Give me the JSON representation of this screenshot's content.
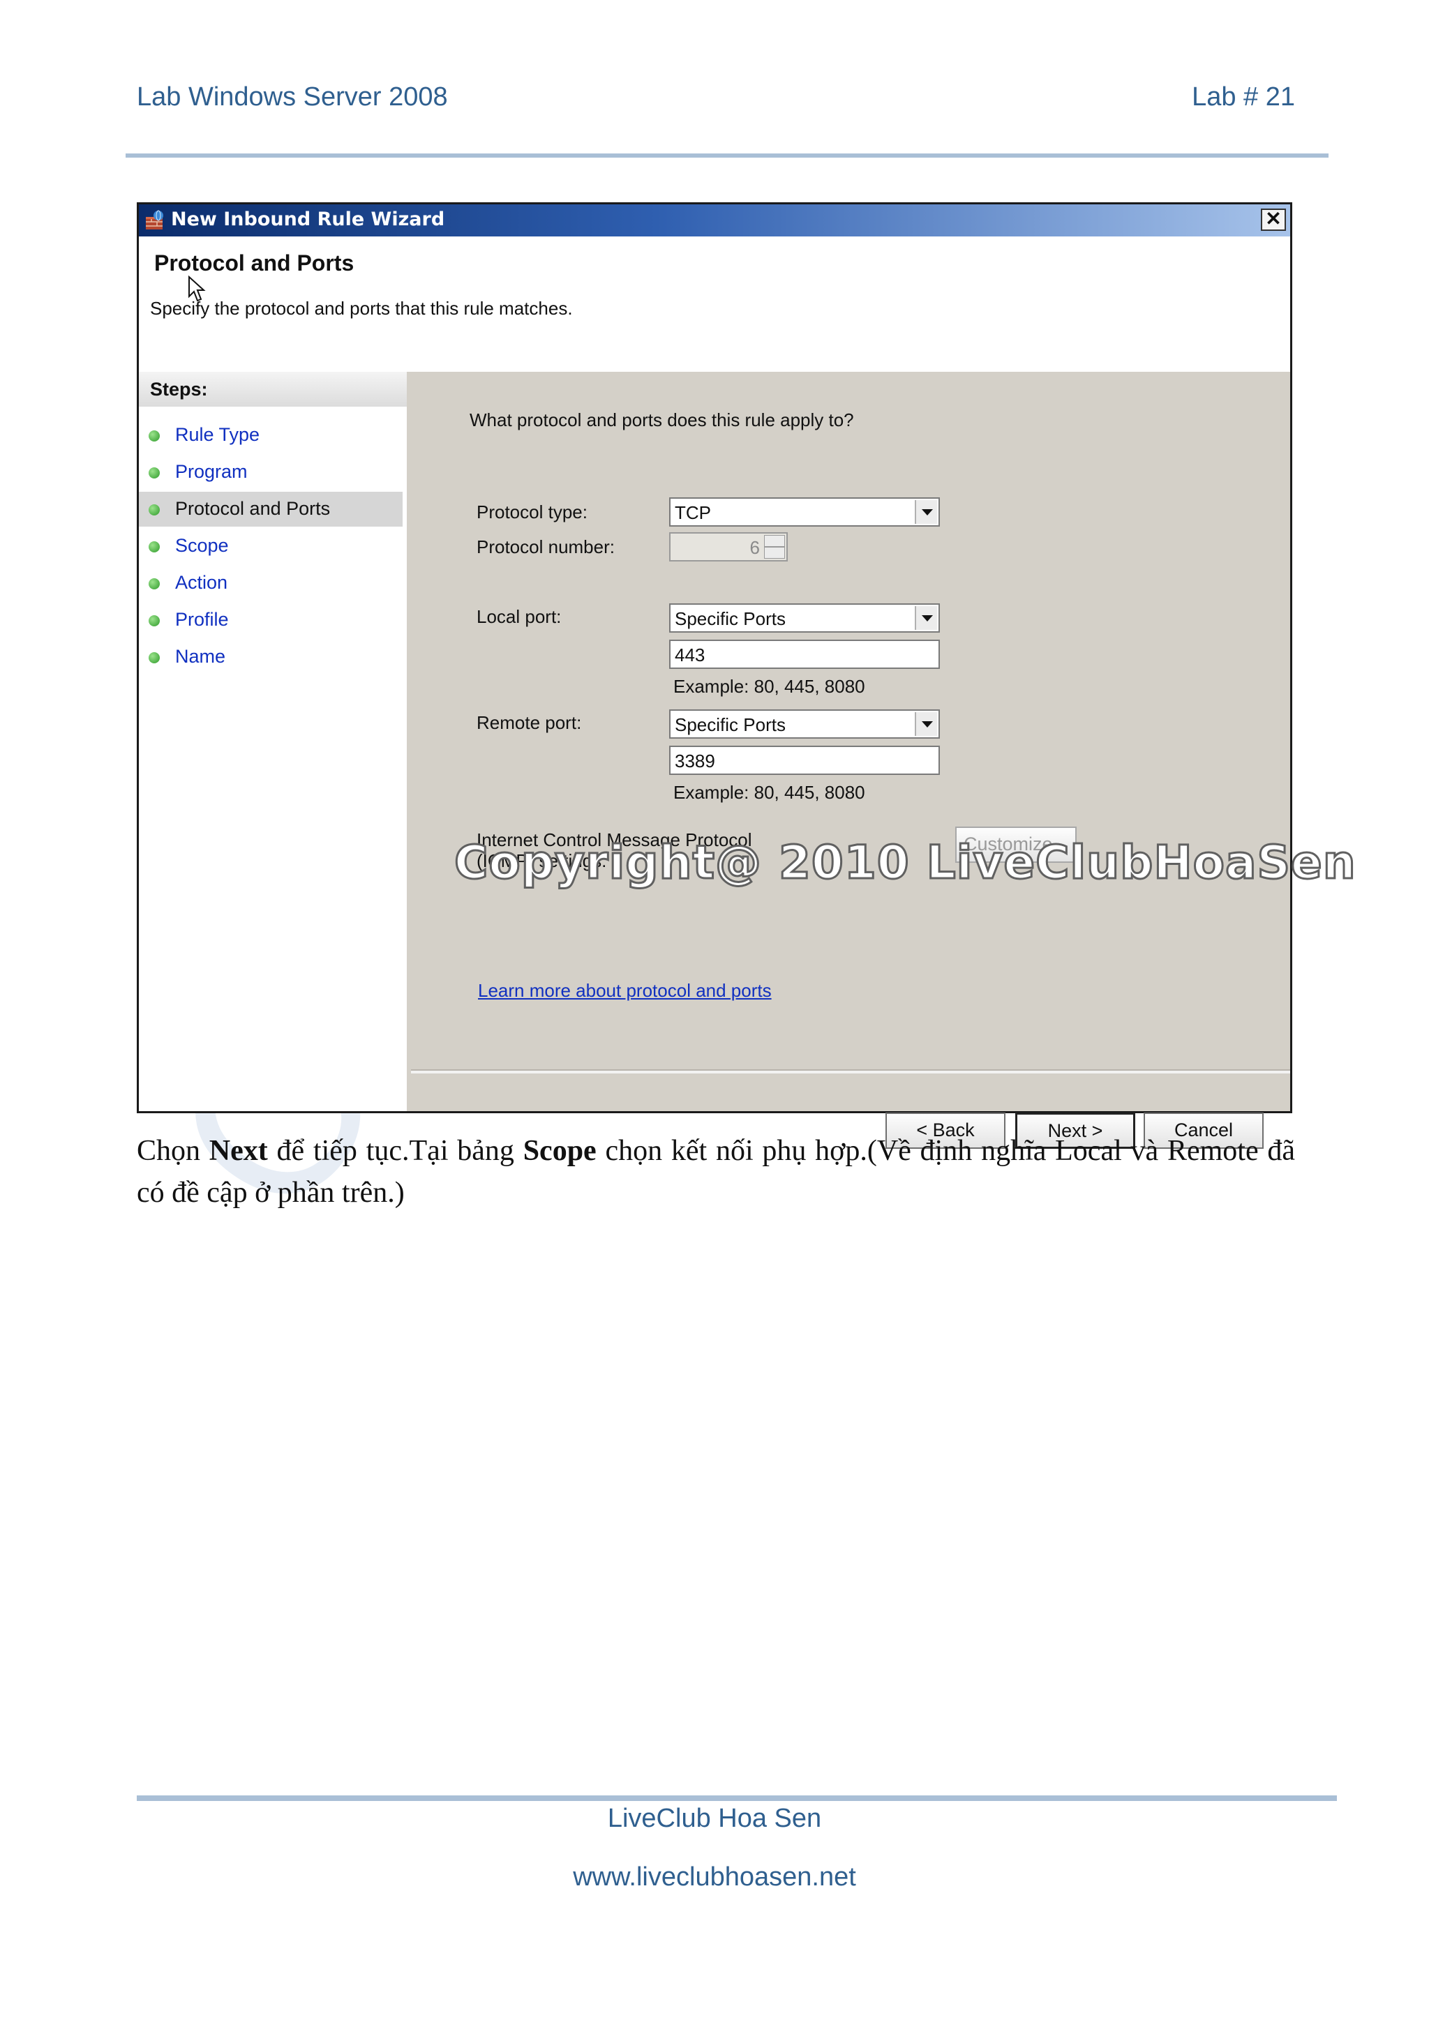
{
  "header": {
    "left": "Lab Windows Server 2008",
    "right": "Lab # 21"
  },
  "watermark_page": "Copyright",
  "dialog": {
    "title": "New Inbound Rule Wizard",
    "close_label": "✕",
    "heading": "Protocol and Ports",
    "subtitle": "Specify the protocol and ports that this rule matches.",
    "steps_title": "Steps:",
    "steps": [
      {
        "label": "Rule Type"
      },
      {
        "label": "Program"
      },
      {
        "label": "Protocol and Ports"
      },
      {
        "label": "Scope"
      },
      {
        "label": "Action"
      },
      {
        "label": "Profile"
      },
      {
        "label": "Name"
      }
    ],
    "active_step": "Protocol and Ports",
    "question": "What protocol and ports does this rule apply to?",
    "protocol_type_label": "Protocol type:",
    "protocol_type_value": "TCP",
    "protocol_number_label": "Protocol number:",
    "protocol_number_value": "6",
    "local_port_label": "Local port:",
    "local_port_mode": "Specific Ports",
    "local_port_value": "443",
    "local_port_example": "Example: 80, 445, 8080",
    "remote_port_label": "Remote port:",
    "remote_port_mode": "Specific Ports",
    "remote_port_value": "3389",
    "remote_port_example": "Example: 80, 445, 8080",
    "icmp_label_line1": "Internet Control Message Protocol",
    "icmp_label_line2": "(ICMP) settings:",
    "customize_label": "Customize...",
    "learn_more": "Learn more about protocol and ports",
    "back_label": "< Back",
    "next_label": "Next >",
    "cancel_label": "Cancel"
  },
  "overlay_watermark": "Copyright@ 2010 LiveClubHoaSen",
  "paragraph": {
    "part1": "Chọn ",
    "bold1": "Next",
    "part2": " để tiếp tục.Tại bảng ",
    "bold2": "Scope",
    "part3": " chọn kết nối phụ hợp.(Về định nghĩa Local và Remote đã có đề cập ở phần trên.)"
  },
  "footer": {
    "line1": "LiveClub Hoa Sen",
    "line2": "www.liveclubhoasen.net"
  }
}
